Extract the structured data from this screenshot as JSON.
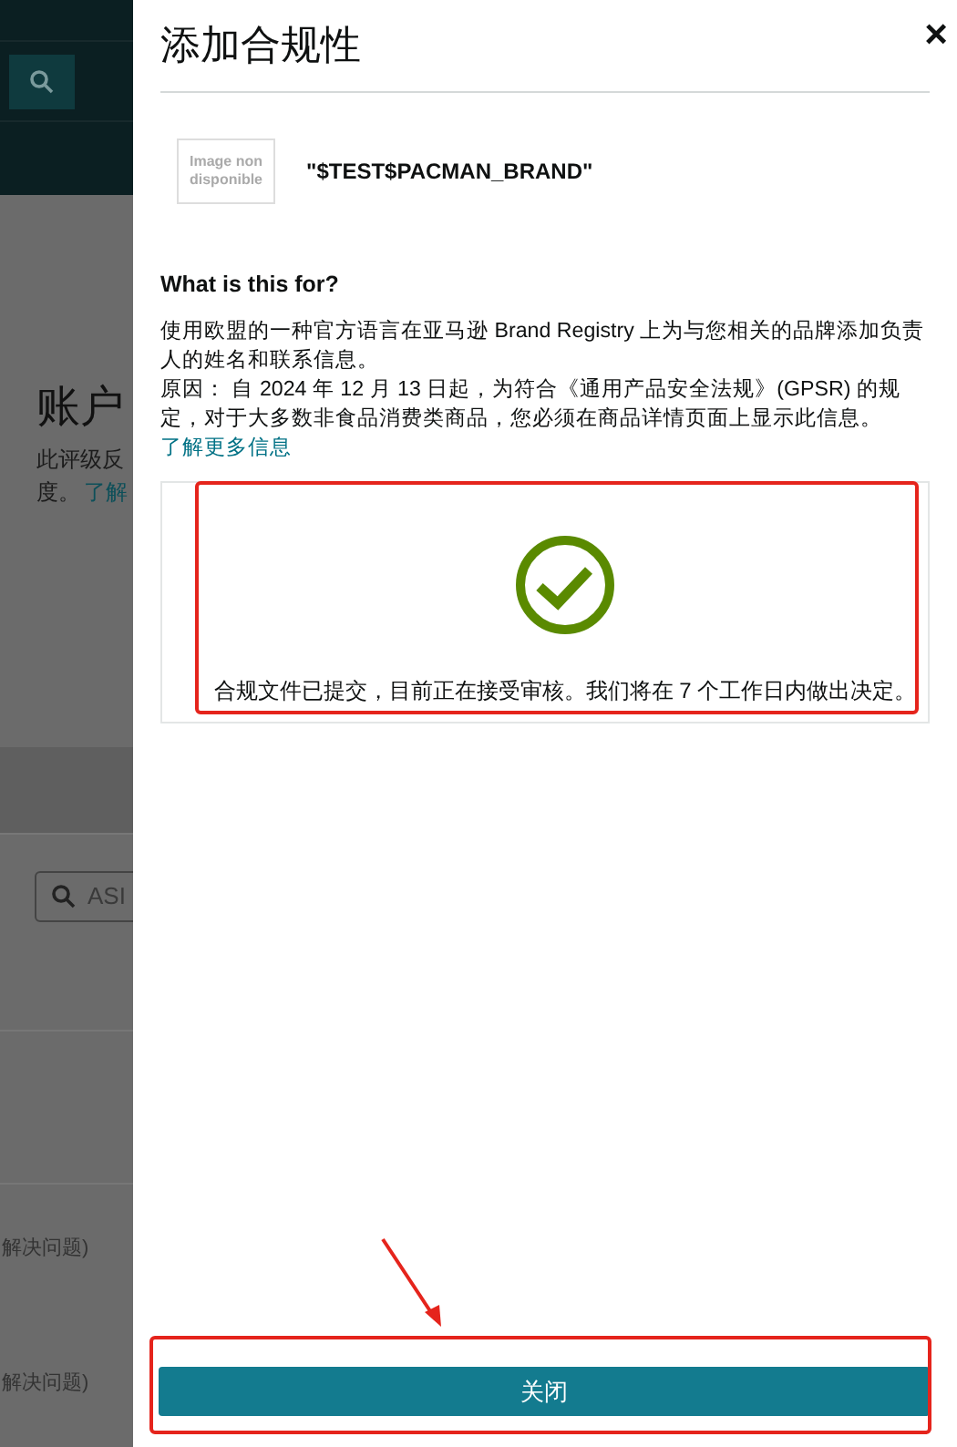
{
  "background_page": {
    "heading": "账户",
    "description_lines": [
      "此评级反",
      "度。"
    ],
    "learn_more_link": "了解",
    "search_field": {
      "placeholder": "ASI"
    },
    "row_texts": [
      "解决问题)",
      "解决问题)"
    ]
  },
  "modal": {
    "title": "添加合规性",
    "close_icon": "×",
    "brand": {
      "image_placeholder": "Image non disponible",
      "name": "\"$TEST$PACMAN_BRAND\""
    },
    "section_heading": "What is this for?",
    "description": "使用欧盟的一种官方语言在亚马逊 Brand Registry 上为与您相关的品牌添加负责人的姓名和联系信息。",
    "reason": "原因： 自 2024 年 12 月 13 日起，为符合《通用产品安全法规》(GPSR) 的规定，对于大多数非食品消费类商品，您必须在商品详情页面上显示此信息。",
    "learn_more_link": "了解更多信息",
    "status": {
      "kind": "success",
      "message": "合规文件已提交，目前正在接受审核。我们将在 7 个工作日内做出决定。"
    },
    "close_button": "关闭"
  }
}
